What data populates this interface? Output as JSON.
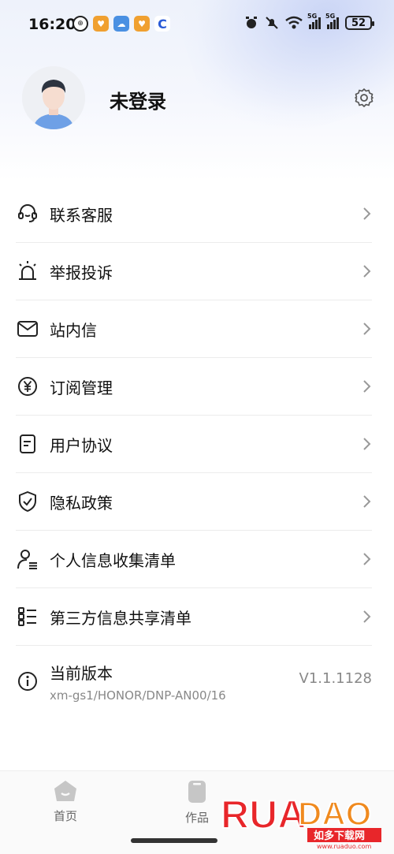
{
  "status_bar": {
    "time": "16:20",
    "battery": "52",
    "signal_label_1": "5G",
    "signal_label_2": "5G"
  },
  "profile": {
    "username": "未登录"
  },
  "menu": {
    "items": [
      {
        "label": "联系客服",
        "icon": "headset-icon"
      },
      {
        "label": "举报投诉",
        "icon": "alarm-light-icon"
      },
      {
        "label": "站内信",
        "icon": "mail-icon"
      },
      {
        "label": "订阅管理",
        "icon": "yuan-icon"
      },
      {
        "label": "用户协议",
        "icon": "document-icon"
      },
      {
        "label": "隐私政策",
        "icon": "shield-check-icon"
      },
      {
        "label": "个人信息收集清单",
        "icon": "user-list-icon"
      },
      {
        "label": "第三方信息共享清单",
        "icon": "list-icon"
      }
    ],
    "version": {
      "title": "当前版本",
      "subtitle": "xm-gs1/HONOR/DNP-AN00/16",
      "number": "V1.1.1128"
    }
  },
  "bottom_nav": {
    "tabs": [
      {
        "label": "首页",
        "icon": "home-icon"
      },
      {
        "label": "作品",
        "icon": "works-icon"
      }
    ]
  },
  "watermark": {
    "brand": "RUANDAO",
    "cn_text": "如多下载网",
    "url": "www.ruaduo.com"
  },
  "colors": {
    "accent_blue": "#3b6fd8",
    "watermark_red": "#e8262a",
    "watermark_orange": "#f08a1e",
    "text_gray": "#888888"
  }
}
